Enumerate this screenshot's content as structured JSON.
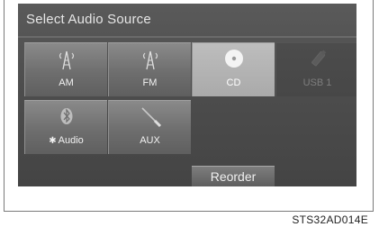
{
  "screen": {
    "title": "Select Audio Source",
    "sources": [
      {
        "label": "AM",
        "icon": "antenna-icon",
        "state": "enabled"
      },
      {
        "label": "FM",
        "icon": "antenna-icon",
        "state": "enabled"
      },
      {
        "label": "CD",
        "icon": "disc-icon",
        "state": "selected"
      },
      {
        "label": "USB 1",
        "icon": "usb-icon",
        "state": "disabled"
      },
      {
        "label": "Audio",
        "icon": "bluetooth-icon",
        "state": "enabled"
      },
      {
        "label": "AUX",
        "icon": "aux-cable-icon",
        "state": "enabled"
      }
    ],
    "reorder_label": "Reorder"
  },
  "figure_code": "STS32AD014E"
}
